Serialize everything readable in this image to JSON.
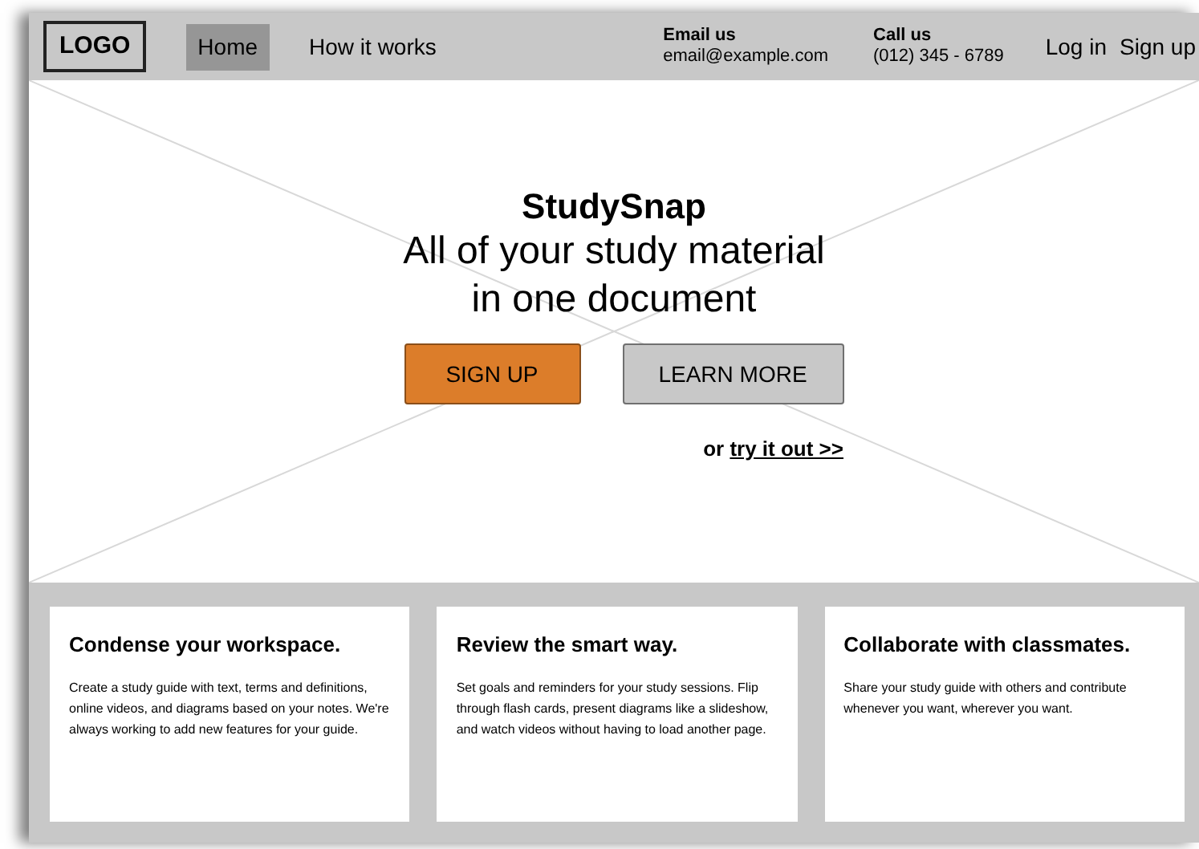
{
  "header": {
    "logo": "LOGO",
    "nav": [
      {
        "label": "Home",
        "selected": true
      },
      {
        "label": "How it works",
        "selected": false
      }
    ],
    "contacts": [
      {
        "label": "Email us",
        "value": "email@example.com"
      },
      {
        "label": "Call us",
        "value": "(012) 345 - 6789"
      }
    ],
    "auth_links": [
      "Log in",
      "Sign up"
    ]
  },
  "hero": {
    "kind": "picture-placeholder",
    "title": "StudySnap",
    "subtitle_lines": [
      "All of your study material",
      "in one document"
    ],
    "buttons": [
      {
        "label": "SIGN UP",
        "kind": "primary"
      },
      {
        "label": "LEARN MORE",
        "kind": "secondary"
      }
    ],
    "try_prefix": "or",
    "try_link": "try it out >>"
  },
  "features": [
    {
      "title": "Condense your workspace.",
      "text": "Create a study guide with text, terms and definitions, online videos, and diagrams based on your notes. We're always working to add new features for your guide."
    },
    {
      "title": "Review the smart way.",
      "text": "Set goals and reminders for your study sessions. Flip through flash cards, present diagrams like a slideshow, and watch videos without having to load another page."
    },
    {
      "title": "Collaborate with classmates.",
      "text": "Share your study guide with others and contribute whenever you want, wherever you want."
    }
  ]
}
